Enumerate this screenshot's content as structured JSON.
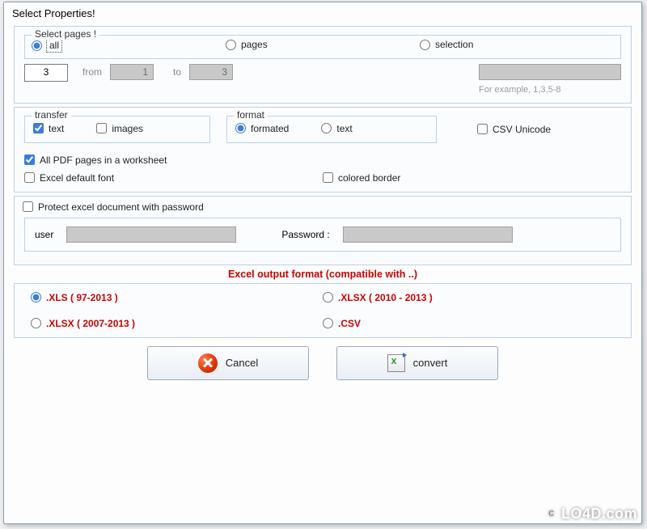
{
  "window": {
    "title": "Select Properties!"
  },
  "pages": {
    "legend": "Select pages !",
    "options": {
      "all": "all",
      "pages": "pages",
      "selection": "selection"
    },
    "selected": "all",
    "count_value": "3",
    "from_label": "from",
    "from_value": "1",
    "to_label": "to",
    "to_value": "3",
    "example_hint": "For example, 1,3,5-8"
  },
  "transfer": {
    "legend": "transfer",
    "text_label": "text",
    "text_checked": true,
    "images_label": "images",
    "images_checked": false
  },
  "format": {
    "legend": "format",
    "options": {
      "formatted": "formated",
      "text": "text"
    },
    "selected": "formatted"
  },
  "csv_unicode": {
    "label": "CSV Unicode",
    "checked": false
  },
  "options": {
    "all_pages_label": "All PDF pages in a worksheet",
    "all_pages_checked": true,
    "excel_font_label": "Excel default font",
    "excel_font_checked": false,
    "colored_border_label": "colored border",
    "colored_border_checked": false
  },
  "protect": {
    "label": "Protect excel document with password",
    "checked": false,
    "user_label": "user",
    "user_value": "",
    "password_label": "Password :",
    "password_value": ""
  },
  "output": {
    "header": "Excel output format (compatible with ..)",
    "choices": {
      "xls": ".XLS  ( 97-2013 )",
      "xlsx2010": ".XLSX  ( 2010 - 2013 )",
      "xlsx2007": ".XLSX ( 2007-2013 )",
      "csv": ".CSV"
    },
    "selected": "xls"
  },
  "buttons": {
    "cancel": "Cancel",
    "convert": "convert"
  },
  "watermark": "LO4D.com"
}
